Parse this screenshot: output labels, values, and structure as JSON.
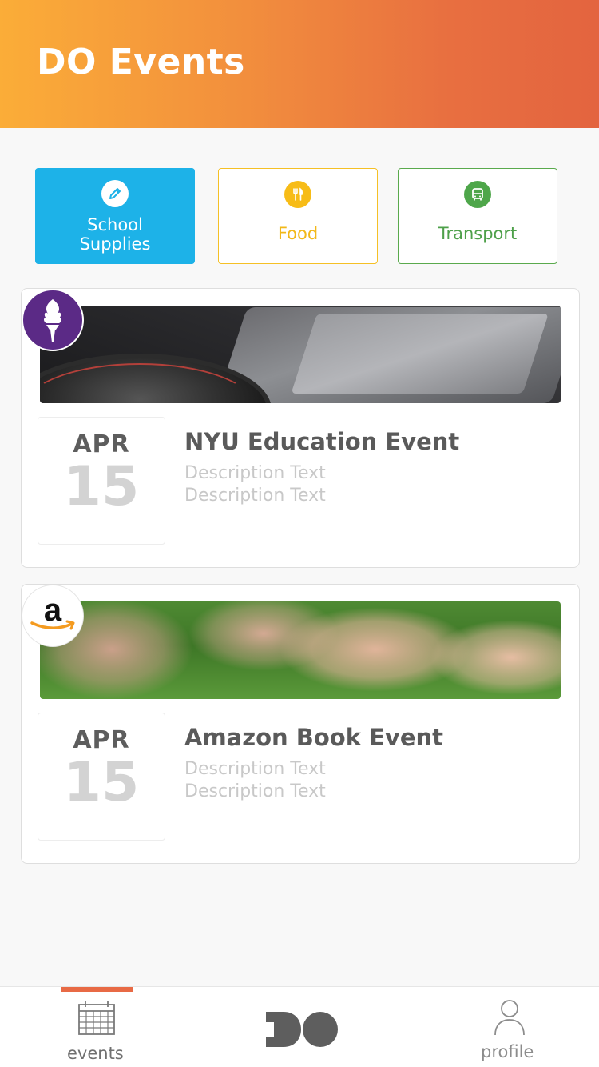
{
  "header": {
    "title": "DO Events"
  },
  "categories": [
    {
      "label": "School\nSupplies",
      "icon": "pencil-icon",
      "color": "#1db2e8"
    },
    {
      "label": "Food",
      "icon": "fork-knife-icon",
      "color": "#f7bc17"
    },
    {
      "label": "Transport",
      "icon": "bus-icon",
      "color": "#4ea64a"
    }
  ],
  "events": [
    {
      "title": "NYU Education Event",
      "month": "APR",
      "day": "15",
      "description": [
        "Description Text",
        "Description Text"
      ],
      "logo": "nyu-torch-logo",
      "image": "camera-photo"
    },
    {
      "title": "Amazon Book Event",
      "month": "APR",
      "day": "15",
      "description": [
        "Description Text",
        "Description Text"
      ],
      "logo": "amazon-logo",
      "image": "hands-on-grass-photo"
    }
  ],
  "tabbar": {
    "events_label": "events",
    "profile_label": "profile",
    "active_tab": "events",
    "accent_color": "#e86a45"
  }
}
